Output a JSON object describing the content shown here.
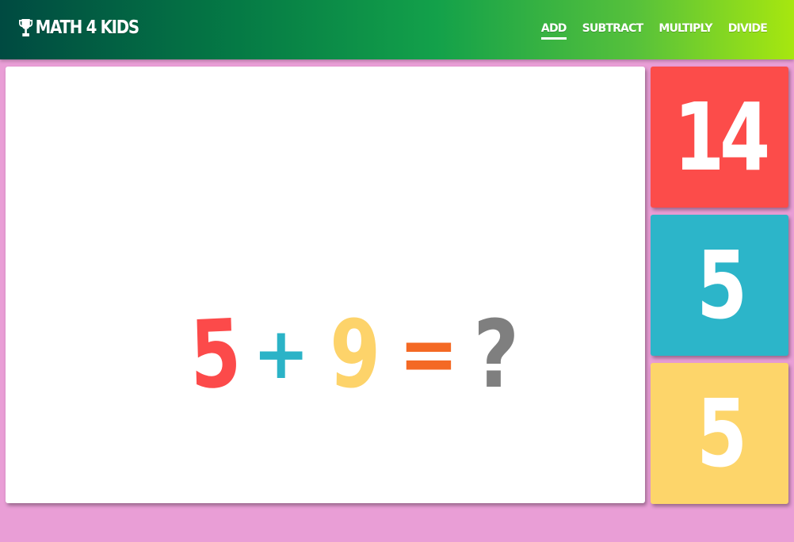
{
  "header": {
    "brand": "MATH 4 KIDS",
    "nav": [
      {
        "label": "ADD",
        "active": true
      },
      {
        "label": "SUBTRACT",
        "active": false
      },
      {
        "label": "MULTIPLY",
        "active": false
      },
      {
        "label": "DIVIDE",
        "active": false
      }
    ]
  },
  "question": {
    "operand_a": "5",
    "operator": "+",
    "operand_b": "9",
    "equals": "=",
    "unknown": "?"
  },
  "answers": [
    {
      "label": "14",
      "color": "#fc4c4a"
    },
    {
      "label": "5",
      "color": "#2cb5c9"
    },
    {
      "label": "5",
      "color": "#fdd56a"
    }
  ],
  "colors": {
    "background": "#e99ed6",
    "operand_a": "#fc4a4a",
    "operator": "#2bb3c7",
    "operand_b": "#fdd36a",
    "equals": "#f46924",
    "unknown": "#7f7f7f"
  },
  "icons": {
    "brand": "trophy-icon"
  }
}
